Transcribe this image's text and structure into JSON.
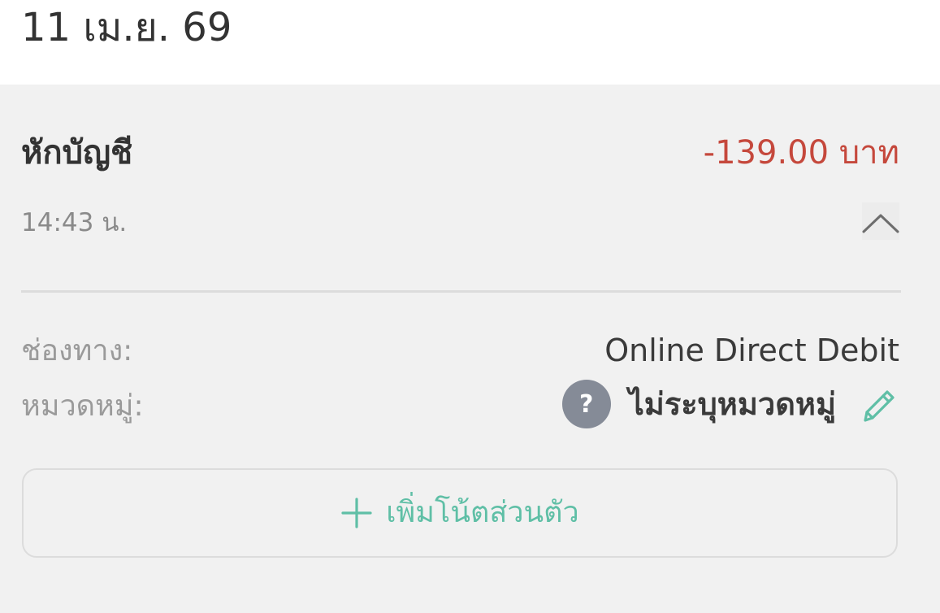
{
  "header": {
    "date": "11 เม.ย. 69"
  },
  "transaction": {
    "title": "หักบัญชี",
    "amount": "-139.00 บาท",
    "time": "14:43 น.",
    "channel_label": "ช่องทาง:",
    "channel_value": "Online Direct Debit",
    "category_label": "หมวดหมู่:",
    "category_icon": "?",
    "category_value": "ไม่ระบุหมวดหมู่"
  },
  "actions": {
    "add_note_label": "เพิ่มโน้ตส่วนตัว"
  },
  "colors": {
    "amount_negative": "#c5483c",
    "accent": "#5fbfa6",
    "panel_bg": "#f1f1f1"
  },
  "icons": {
    "collapse": "chevron-up-icon",
    "category": "question-icon",
    "edit": "pencil-icon",
    "add": "plus-icon"
  }
}
